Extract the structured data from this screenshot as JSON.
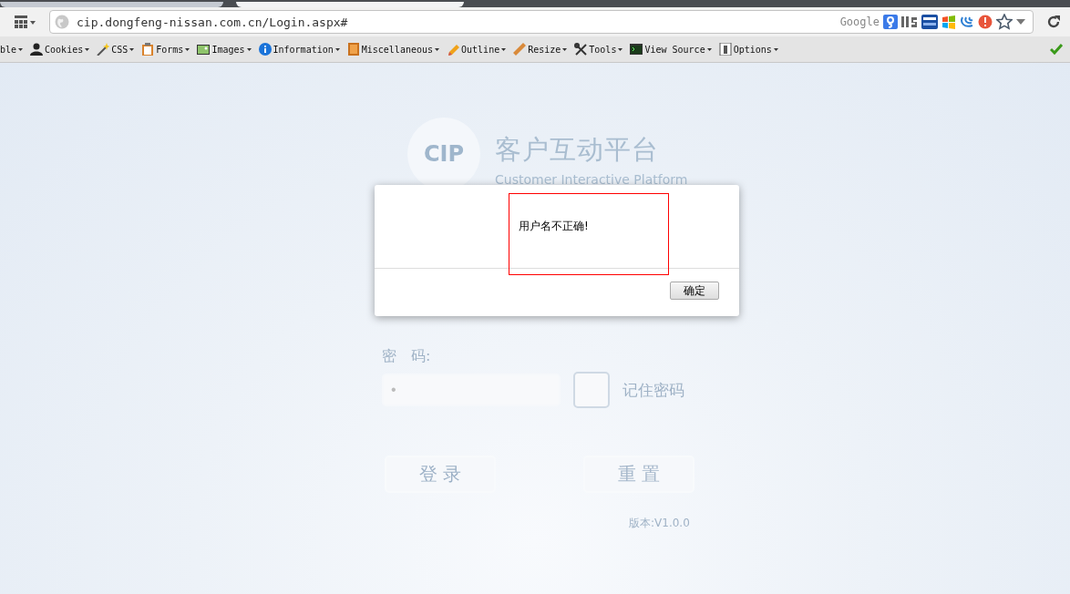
{
  "browser": {
    "tabs": [
      {
        "selected": false
      },
      {
        "selected": true
      }
    ],
    "address_bar": {
      "url": "cip.dongfeng-nissan.com.cn/Login.aspx#",
      "search_engine": "Google"
    },
    "dev_toolbar": [
      {
        "kind": "none",
        "label": "ble"
      },
      {
        "kind": "cookies",
        "label": "Cookies"
      },
      {
        "kind": "css",
        "label": "CSS"
      },
      {
        "kind": "forms",
        "label": "Forms"
      },
      {
        "kind": "images",
        "label": "Images"
      },
      {
        "kind": "information",
        "label": "Information"
      },
      {
        "kind": "miscellaneous",
        "label": "Miscellaneous"
      },
      {
        "kind": "outline",
        "label": "Outline"
      },
      {
        "kind": "resize",
        "label": "Resize"
      },
      {
        "kind": "tools",
        "label": "Tools"
      },
      {
        "kind": "view-source",
        "label": "View Source"
      },
      {
        "kind": "options",
        "label": "Options"
      }
    ]
  },
  "login": {
    "logo_text": "CIP",
    "title": "客户互动平台",
    "subtitle": "Customer Interactive Platform",
    "password_label": "密　码:",
    "password_value": "•",
    "remember": {
      "label": "记住密码",
      "checked": false
    },
    "buttons": [
      {
        "kind": "login",
        "label": "登 录"
      },
      {
        "kind": "reset",
        "label": "重 置"
      }
    ],
    "version": "版本:V1.0.0"
  },
  "dialog": {
    "message": "用户名不正确!",
    "highlighted": true,
    "ok": "确定"
  }
}
